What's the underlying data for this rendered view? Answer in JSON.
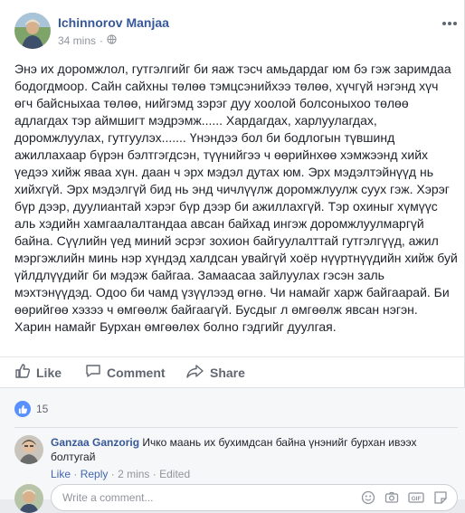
{
  "post": {
    "author": "Ichinnorov Manjaa",
    "time": "34 mins",
    "privacy_icon": "globe-icon",
    "text": "Энэ их доромжлол, гутгэлгийг би яаж тэсч амьдардаг юм бэ гэж заримдаа бодогдмоор. Сайн сайхны төлөө тэмцсэнийхээ төлөө, хүчгүй нэгэнд хүч өгч байсныхаа төлөө, нийгэмд зэрэг дуу хоолой болсоныхоо төлөө адлагдах тэр аймшигт мэдрэмж...... Хардагдах, харлуулагдах, доромжлуулах, гутгуулэх....... Үнэндээ бол би бодлогын түвшинд ажиллахаар бүрэн бэлтгэгдсэн, түүнийгээ ч өөрийнхөө хэмжээнд хийх үедээ хийж яваа хүн. даан ч эрх мэдэл дутах юм. Эрх мэдэлтэйнүүд нь хийхгүй. Эрх мэдэлгүй бид нь энд чичлүүлж доромжлуулж суух гэж. Хэрэг бүр дээр, дуулиантай хэрэг бүр дээр би ажиллахгүй. Тэр охиныг хүмүүс аль хэдийн хамгаалалтандаа авсан байхад ингэж доромжлуулмаргүй байна. Сүүлийн үед миний эсрэг зохион байгуулалттай гутгэлгүүд, ажил мэргэжлийн минь нэр хүндэд халдсан увайгүй хоёр нүүртнүүдийн хийж буй үйлдлүүдийг би мэдэж байгаа. Замаасаа зайлуулах гэсэн заль мэхтэнүүдэд. Одоо би чамд үзүүлээд өгнө. Чи намайг харж байгаарай. Би өөрийгөө хэзээ ч өмгөөлж байгаагүй. Бусдыг л өмгөөлж явсан нэгэн. Харин намайг Бурхан өмгөөлөх болно гэдгийг дуулгая."
  },
  "actions": {
    "like": "Like",
    "comment": "Comment",
    "share": "Share"
  },
  "reactions": {
    "count": "15"
  },
  "comment": {
    "author": "Ganzaa Ganzorig",
    "text": "Ичко маань их бухимдсан байна үнэнийг бурхан ивээх болтугай",
    "like": "Like",
    "reply": "Reply",
    "time": "2 mins",
    "edited": "Edited"
  },
  "write": {
    "placeholder": "Write a comment..."
  },
  "colors": {
    "link": "#365899",
    "like_blue": "#5890ff",
    "muted": "#90949c",
    "action": "#606770"
  }
}
